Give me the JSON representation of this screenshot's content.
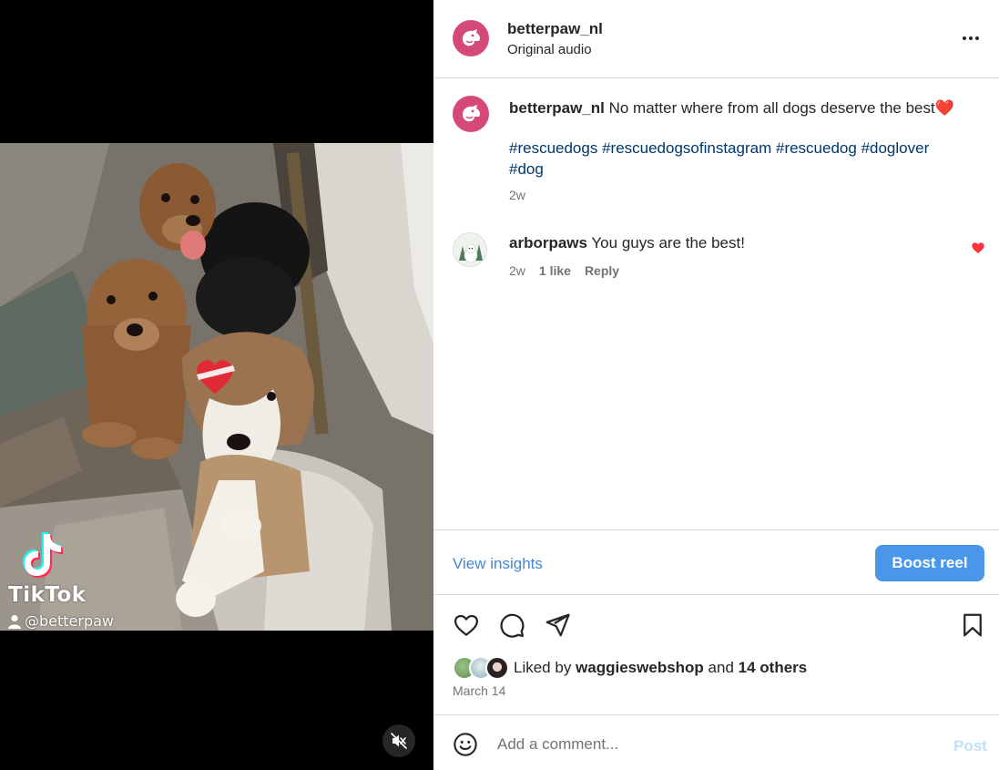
{
  "media": {
    "watermark_brand": "TikTok",
    "watermark_handle": "@betterpaw",
    "mute_icon": "speaker-muted-icon"
  },
  "header": {
    "username": "betterpaw_nl",
    "subtitle": "Original audio",
    "more_icon": "more-horizontal-icon"
  },
  "caption": {
    "username": "betterpaw_nl",
    "text": "No matter where from all dogs deserve the best",
    "emoji": "❤️",
    "hashtags": [
      "#rescuedogs",
      "#rescuedogsofinstagram",
      "#rescuedog",
      "#doglover",
      "#dog"
    ],
    "time": "2w"
  },
  "comment": {
    "username": "arborpaws",
    "text": "You guys are the best!",
    "time": "2w",
    "likes": "1 like",
    "reply": "Reply",
    "liked": true
  },
  "insights": {
    "view_label": "View insights",
    "boost_label": "Boost reel"
  },
  "likes": {
    "prefix": "Liked by",
    "top_user": "waggieswebshop",
    "joiner": "and",
    "others": "14 others"
  },
  "post_date": "March 14",
  "comment_box": {
    "placeholder": "Add a comment...",
    "post_label": "Post"
  },
  "colors": {
    "brand_pink": "#d4497a",
    "link_blue": "#00376b",
    "accent_blue": "#4a97ea",
    "heart_red": "#ff3040"
  }
}
